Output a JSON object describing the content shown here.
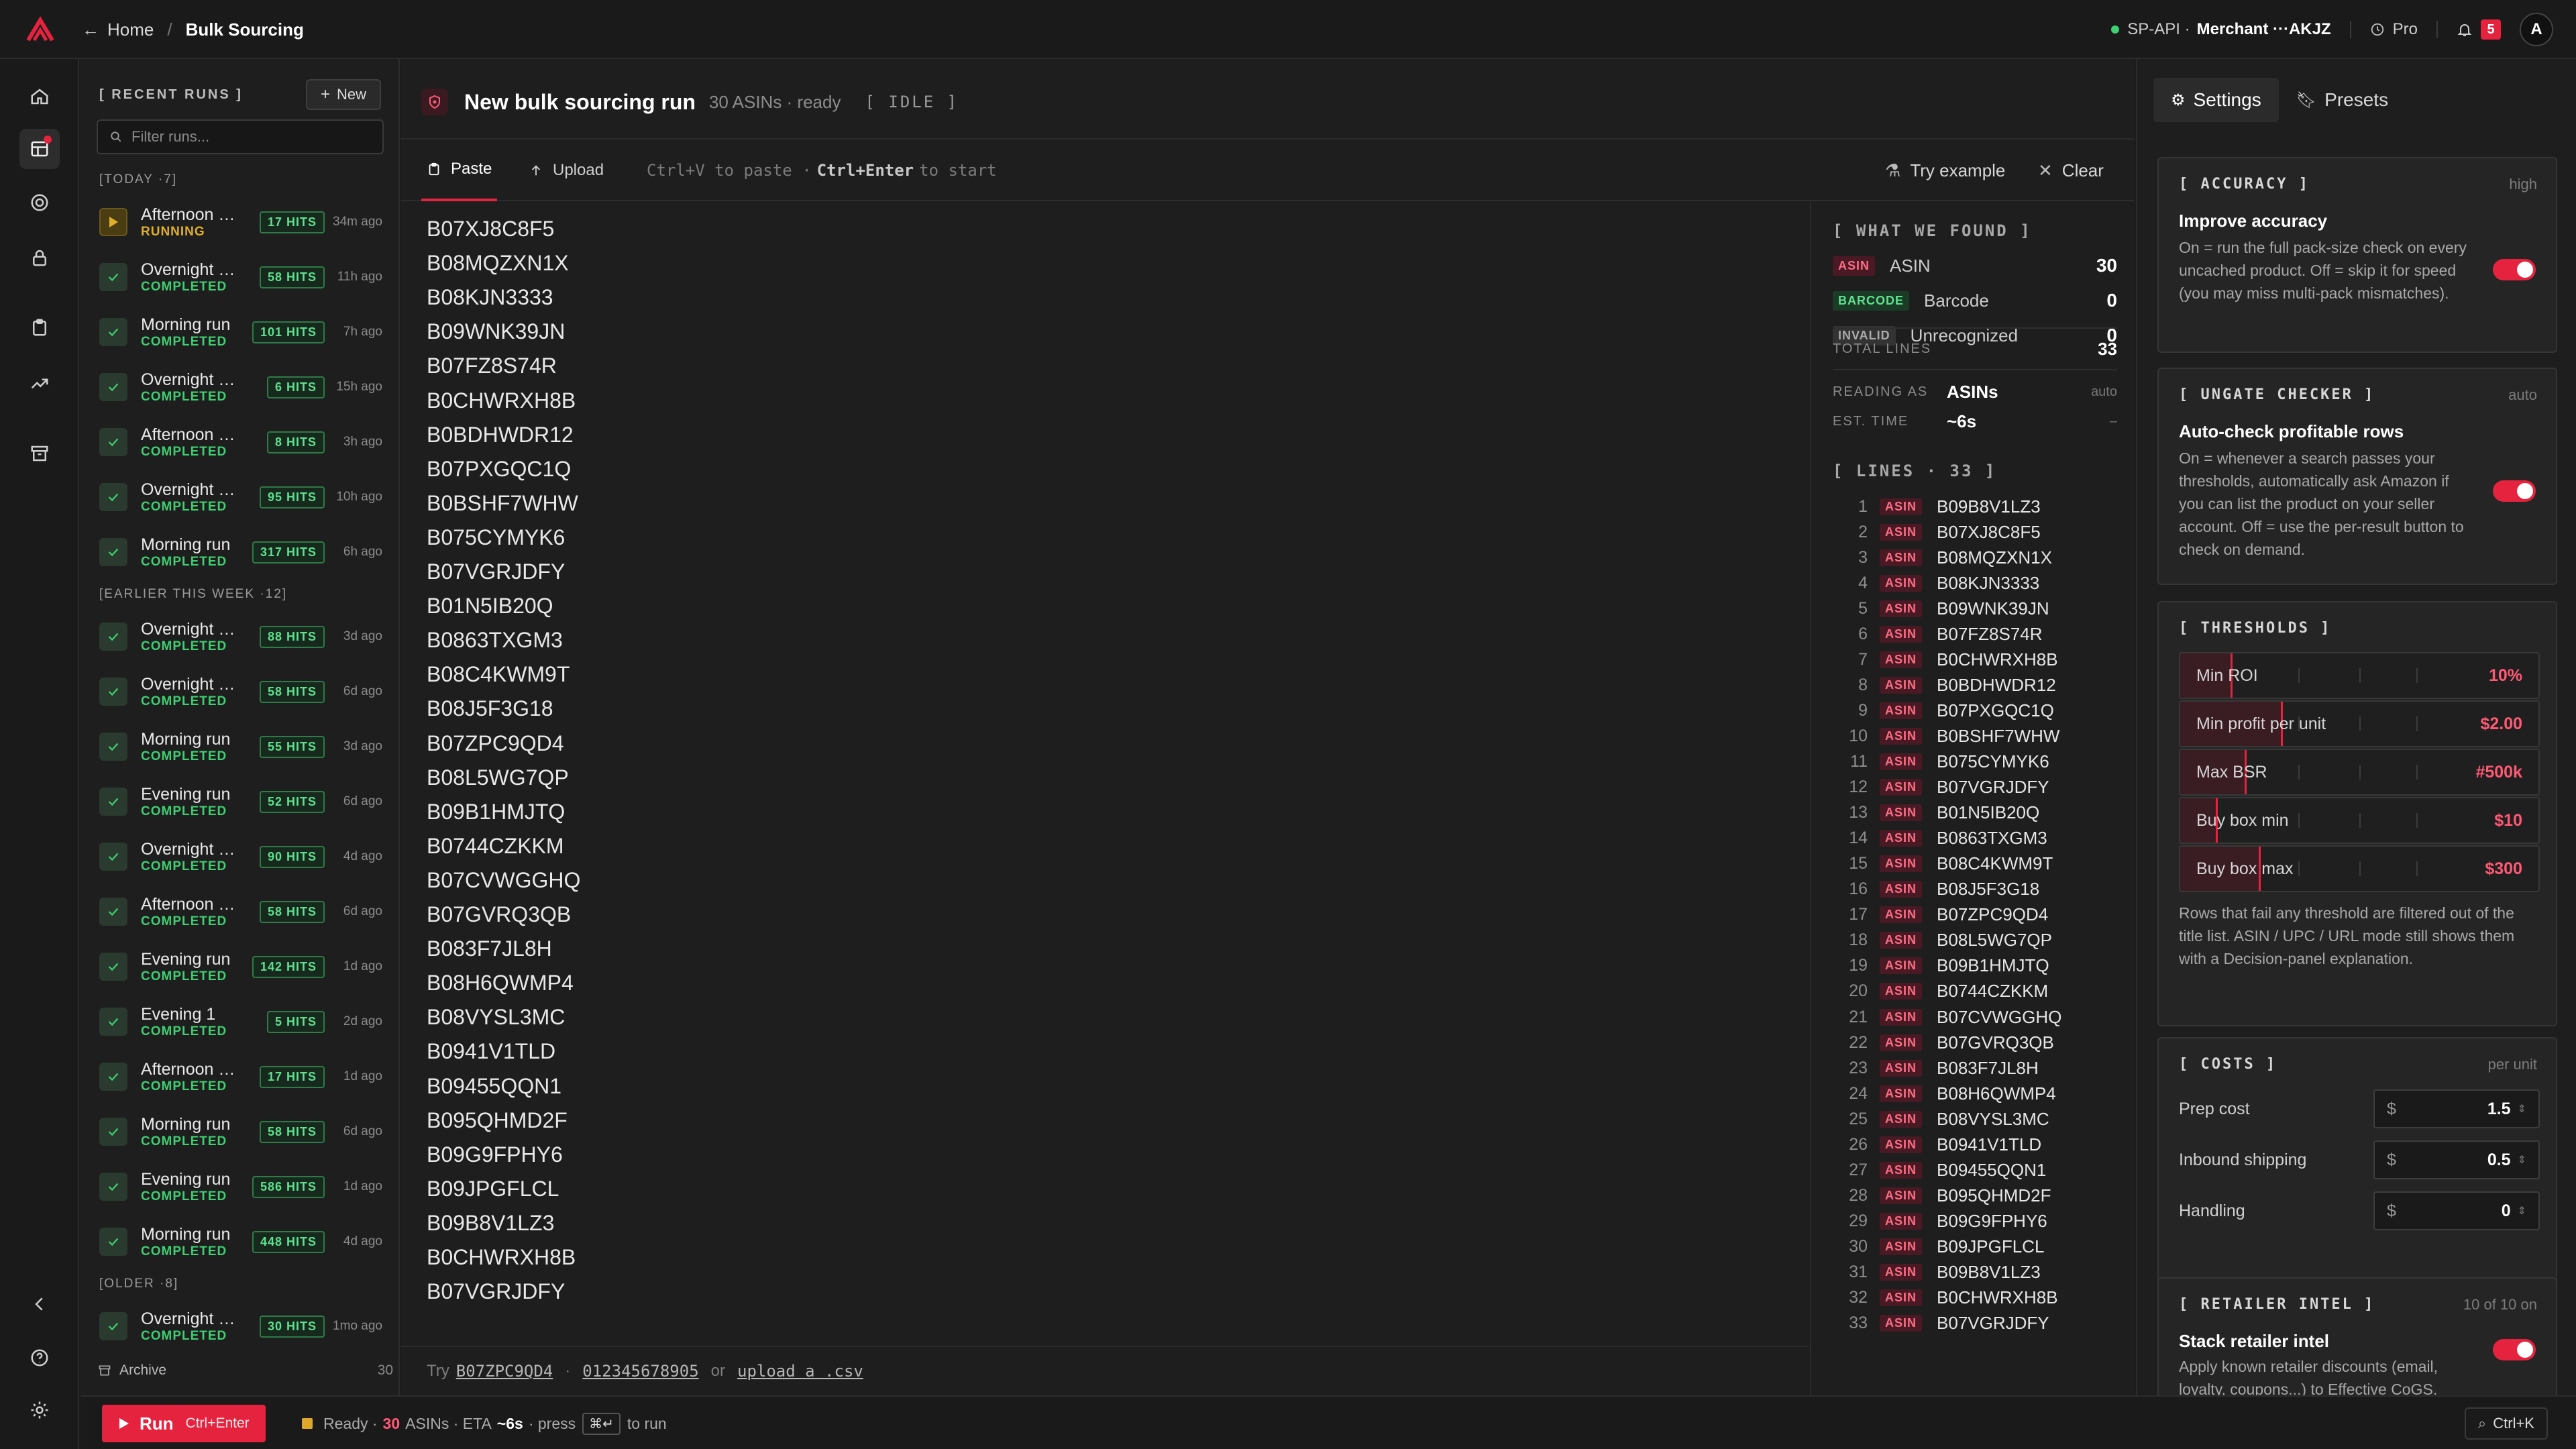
{
  "topbar": {
    "home_label": "Home",
    "current_page": "Bulk Sourcing",
    "api_label": "SP-API ·",
    "merchant": "Merchant ···AKJZ",
    "plan": "Pro",
    "notifications": "5",
    "avatar": "A"
  },
  "runs": {
    "title": "[ RECENT RUNS ]",
    "new_label": "New",
    "filter_placeholder": "Filter runs...",
    "groups": [
      {
        "label": "[TODAY ·7]",
        "items": [
          {
            "name": "Afternoon run",
            "state": "RUNNING",
            "hits": "17 HITS",
            "ago": "34m ago"
          },
          {
            "name": "Overnight run",
            "state": "COMPLETED",
            "hits": "58 HITS",
            "ago": "11h ago"
          },
          {
            "name": "Morning run",
            "state": "COMPLETED",
            "hits": "101 HITS",
            "ago": "7h ago"
          },
          {
            "name": "Overnight run",
            "state": "COMPLETED",
            "hits": "6 HITS",
            "ago": "15h ago"
          },
          {
            "name": "Afternoon run",
            "state": "COMPLETED",
            "hits": "8 HITS",
            "ago": "3h ago"
          },
          {
            "name": "Overnight run",
            "state": "COMPLETED",
            "hits": "95 HITS",
            "ago": "10h ago"
          },
          {
            "name": "Morning run",
            "state": "COMPLETED",
            "hits": "317 HITS",
            "ago": "6h ago"
          }
        ]
      },
      {
        "label": "[EARLIER THIS WEEK ·12]",
        "items": [
          {
            "name": "Overnight run",
            "state": "COMPLETED",
            "hits": "88 HITS",
            "ago": "3d ago"
          },
          {
            "name": "Overnight run",
            "state": "COMPLETED",
            "hits": "58 HITS",
            "ago": "6d ago"
          },
          {
            "name": "Morning run",
            "state": "COMPLETED",
            "hits": "55 HITS",
            "ago": "3d ago"
          },
          {
            "name": "Evening run",
            "state": "COMPLETED",
            "hits": "52 HITS",
            "ago": "6d ago"
          },
          {
            "name": "Overnight run",
            "state": "COMPLETED",
            "hits": "90 HITS",
            "ago": "4d ago"
          },
          {
            "name": "Afternoon run",
            "state": "COMPLETED",
            "hits": "58 HITS",
            "ago": "6d ago"
          },
          {
            "name": "Evening run",
            "state": "COMPLETED",
            "hits": "142 HITS",
            "ago": "1d ago"
          },
          {
            "name": "Evening 1",
            "state": "COMPLETED",
            "hits": "5 HITS",
            "ago": "2d ago"
          },
          {
            "name": "Afternoon run",
            "state": "COMPLETED",
            "hits": "17 HITS",
            "ago": "1d ago"
          },
          {
            "name": "Morning run",
            "state": "COMPLETED",
            "hits": "58 HITS",
            "ago": "6d ago"
          },
          {
            "name": "Evening run",
            "state": "COMPLETED",
            "hits": "586 HITS",
            "ago": "1d ago"
          },
          {
            "name": "Morning run",
            "state": "COMPLETED",
            "hits": "448 HITS",
            "ago": "4d ago"
          }
        ]
      },
      {
        "label": "[OLDER ·8]",
        "items": [
          {
            "name": "Overnight run",
            "state": "COMPLETED",
            "hits": "30 HITS",
            "ago": "1mo ago"
          }
        ]
      }
    ],
    "archive_label": "Archive",
    "archive_count": "30"
  },
  "main": {
    "title": "New bulk sourcing run",
    "subtitle": "30 ASINs · ready",
    "status": "[ IDLE ]",
    "tab_paste": "Paste",
    "tab_upload": "Upload",
    "hint_prefix": "Ctrl+V to paste ·",
    "hint_key": "Ctrl+Enter",
    "hint_suffix": "to start",
    "try_example": "Try example",
    "clear": "Clear",
    "pasted_lines": [
      "B07XJ8C8F5",
      "B08MQZXN1X",
      "B08KJN3333",
      "B09WNK39JN",
      "B07FZ8S74R",
      "B0CHWRXH8B",
      "B0BDHWDR12",
      "B07PXGQC1Q",
      "B0BSHF7WHW",
      "B075CYMYK6",
      "B07VGRJDFY",
      "B01N5IB20Q",
      "B0863TXGM3",
      "B08C4KWM9T",
      "B08J5F3G18",
      "B07ZPC9QD4",
      "B08L5WG7QP",
      "B09B1HMJTQ",
      "B0744CZKKM",
      "B07CVWGGHQ",
      "B07GVRQ3QB",
      "B083F7JL8H",
      "B08H6QWMP4",
      "B08VYSL3MC",
      "B0941V1TLD",
      "B09455QQN1",
      "B095QHMD2F",
      "B09G9FPHY6",
      "B09JPGFLCL",
      "B09B8V1LZ3",
      "B0CHWRXH8B",
      "B07VGRJDFY"
    ],
    "footer_try": "Try",
    "footer_ex1": "B07ZPC9QD4",
    "footer_ex2": "012345678905",
    "footer_or": "or",
    "footer_upload": "upload a .csv"
  },
  "found": {
    "title": "[ WHAT WE FOUND ]",
    "rows": [
      {
        "tag": "ASIN",
        "label": "ASIN",
        "count": "30"
      },
      {
        "tag": "BARCODE",
        "label": "Barcode",
        "count": "0"
      },
      {
        "tag": "INVALID",
        "label": "Unrecognized",
        "count": "0"
      }
    ],
    "total_label": "TOTAL LINES",
    "total_value": "33",
    "reading_label": "READING AS",
    "reading_value": "ASINs",
    "reading_meta": "auto",
    "est_label": "EST. TIME",
    "est_value": "~6s",
    "est_meta": "–",
    "lines_title": "[ LINES · 33 ]",
    "line_tag": "ASIN",
    "lines": [
      "B09B8V1LZ3",
      "B07XJ8C8F5",
      "B08MQZXN1X",
      "B08KJN3333",
      "B09WNK39JN",
      "B07FZ8S74R",
      "B0CHWRXH8B",
      "B0BDHWDR12",
      "B07PXGQC1Q",
      "B0BSHF7WHW",
      "B075CYMYK6",
      "B07VGRJDFY",
      "B01N5IB20Q",
      "B0863TXGM3",
      "B08C4KWM9T",
      "B08J5F3G18",
      "B07ZPC9QD4",
      "B08L5WG7QP",
      "B09B1HMJTQ",
      "B0744CZKKM",
      "B07CVWGGHQ",
      "B07GVRQ3QB",
      "B083F7JL8H",
      "B08H6QWMP4",
      "B08VYSL3MC",
      "B0941V1TLD",
      "B09455QQN1",
      "B095QHMD2F",
      "B09G9FPHY6",
      "B09JPGFLCL",
      "B09B8V1LZ3",
      "B0CHWRXH8B",
      "B07VGRJDFY"
    ]
  },
  "settings": {
    "tab_settings": "Settings",
    "tab_presets": "Presets",
    "accuracy": {
      "header": "[ ACCURACY ]",
      "meta": "high",
      "title": "Improve accuracy",
      "desc": "On = run the full pack-size check on every uncached product. Off = skip it for speed (you may miss multi-pack mismatches).",
      "enabled": true
    },
    "ungate": {
      "header": "[ UNGATE CHECKER ]",
      "meta": "auto",
      "title": "Auto-check profitable rows",
      "desc": "On = whenever a search passes your thresholds, automatically ask Amazon if you can list the product on your seller account. Off = use the per-result button to check on demand.",
      "enabled": true
    },
    "thresholds": {
      "header": "[ THRESHOLDS ]",
      "rows": [
        {
          "label": "Min ROI",
          "value": "10%",
          "level": 0.14
        },
        {
          "label": "Min profit per unit",
          "value": "$2.00",
          "level": 0.28
        },
        {
          "label": "Max BSR",
          "value": "#500k",
          "level": 0.18
        },
        {
          "label": "Buy box min",
          "value": "$10",
          "level": 0.1
        },
        {
          "label": "Buy box max",
          "value": "$300",
          "level": 0.22
        }
      ],
      "note": "Rows that fail any threshold are filtered out of the title list. ASIN / UPC / URL mode still shows them with a Decision-panel explanation."
    },
    "costs": {
      "header": "[ COSTS ]",
      "meta": "per unit",
      "currency": "$",
      "rows": [
        {
          "label": "Prep cost",
          "value": "1.5"
        },
        {
          "label": "Inbound shipping",
          "value": "0.5"
        },
        {
          "label": "Handling",
          "value": "0"
        }
      ]
    },
    "retailer": {
      "header": "[ RETAILER INTEL ]",
      "meta": "10 of 10 on",
      "title": "Stack retailer intel",
      "desc": "Apply known retailer discounts (email, loyalty, coupons...) to Effective CoGS.",
      "enabled": true
    }
  },
  "bottom": {
    "run_label": "Run",
    "run_kbd": "Ctrl+Enter",
    "status_ready": "Ready ·",
    "status_count": "30",
    "status_asins": "ASINs · ETA",
    "status_eta": "~6s",
    "status_press": "· press",
    "status_key": "⌘↵",
    "status_torun": "to run",
    "search_kbd": "Ctrl+K"
  },
  "colors": {
    "accent": "#e5233f",
    "success": "#3ecf71",
    "warning": "#e0b02a",
    "background": "#1c1c1c"
  }
}
